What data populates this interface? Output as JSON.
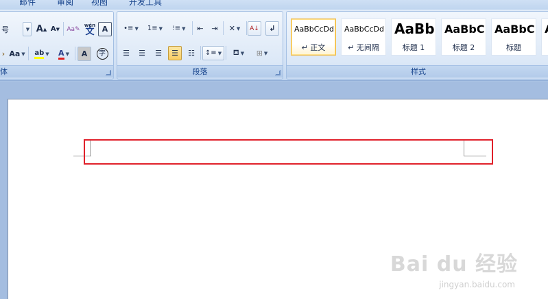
{
  "tabs": [
    "邮件",
    "审阅",
    "视图",
    "开发工具"
  ],
  "font_group": {
    "label": "体",
    "size_suffix": "号",
    "grow_font": "A",
    "shrink_font": "A",
    "clear_format": "Aa",
    "phonetic": "wén",
    "phonetic_char": "文",
    "char_border": "A",
    "change_case": "Aa",
    "highlight_text": "ab",
    "font_color": "A",
    "char_shading": "A",
    "enclose_char": "字"
  },
  "paragraph_group": {
    "label": "段落"
  },
  "styles_group": {
    "label": "样式",
    "items": [
      {
        "sample": "AaBbCcDd",
        "name": "↵ 正文",
        "selected": true
      },
      {
        "sample": "AaBbCcDd",
        "name": "↵ 无间隔",
        "selected": false
      },
      {
        "sample": "AaBb",
        "name": "标题 1",
        "selected": false
      },
      {
        "sample": "AaBbC",
        "name": "标题 2",
        "selected": false
      },
      {
        "sample": "AaBbC",
        "name": "标题",
        "selected": false
      },
      {
        "sample": "A",
        "name": "",
        "selected": false
      }
    ]
  },
  "watermark": {
    "brand": "Bai du 经验",
    "url": "jingyan.baidu.com"
  },
  "colors": {
    "highlight_box": "#e0202a",
    "ribbon_text": "#15428b"
  }
}
